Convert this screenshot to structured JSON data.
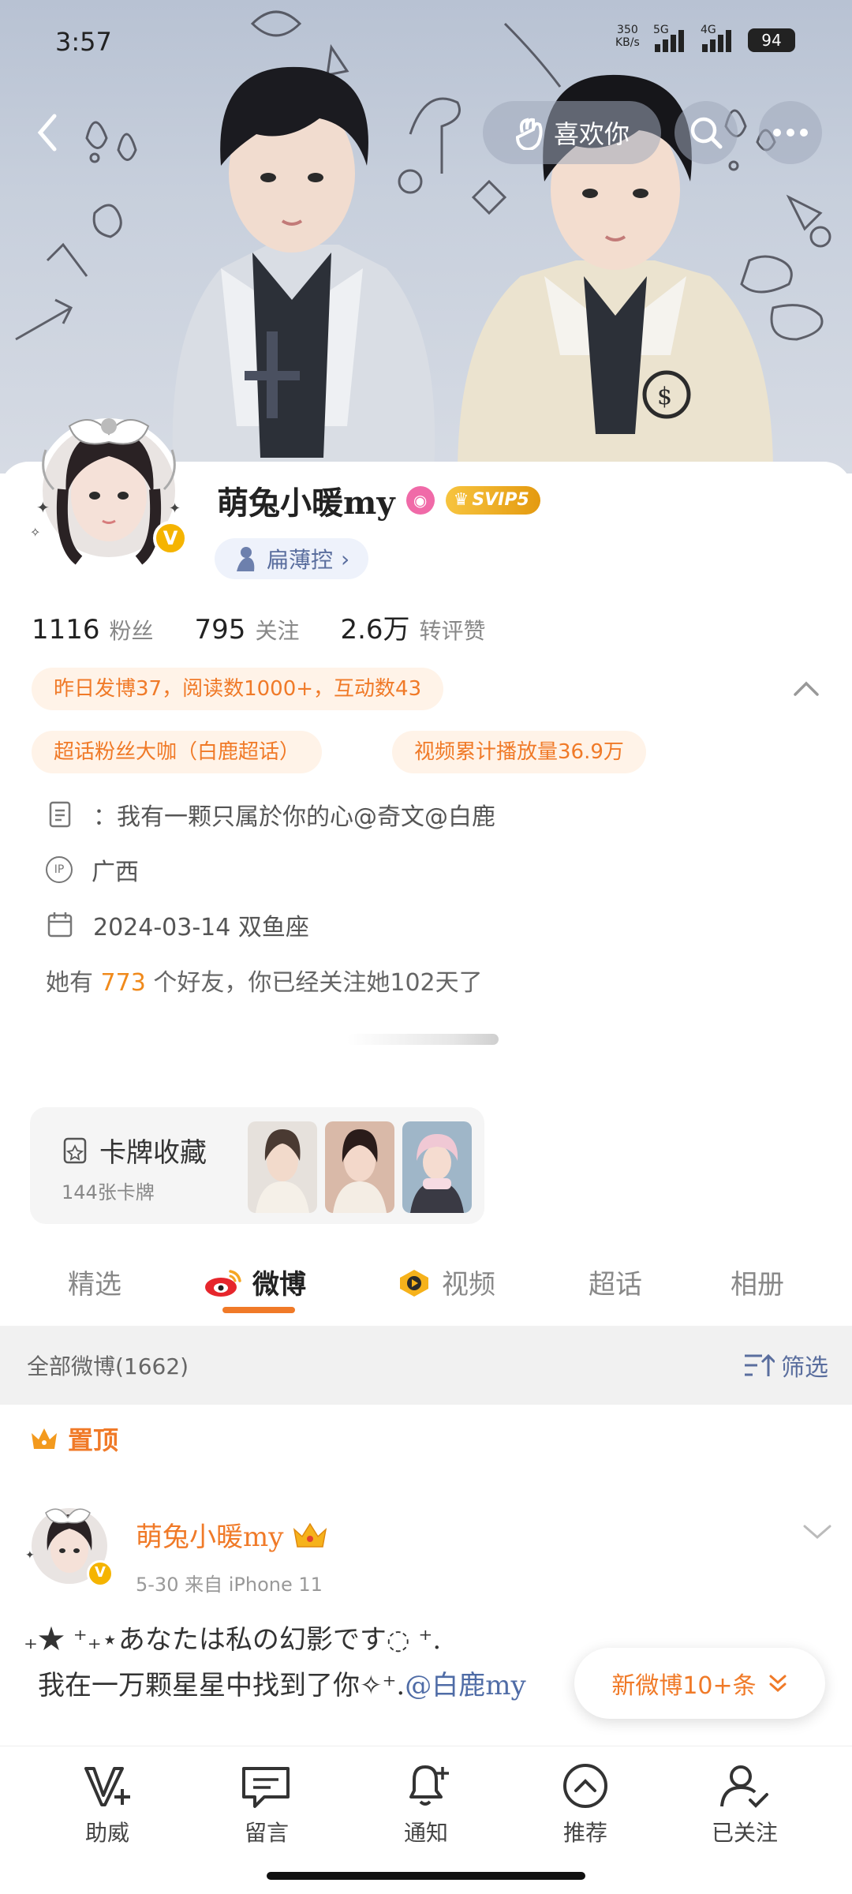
{
  "status_bar": {
    "time": "3:57",
    "net_speed": "350",
    "net_unit": "KB/s",
    "network": "5G",
    "network2": "4G",
    "battery": "94"
  },
  "header": {
    "like_label": "喜欢你"
  },
  "profile": {
    "name": "萌兔小暖my",
    "vip_label": "SVIP5",
    "tag_label": "扁薄控",
    "tag_chevron": "›"
  },
  "stats": [
    {
      "num": "1116",
      "label": "粉丝"
    },
    {
      "num": "795",
      "label": "关注"
    },
    {
      "num": "2.6万",
      "label": "转评赞"
    }
  ],
  "chips": {
    "daily": "昨日发博37，阅读数1000+，互动数43",
    "fan": "超话粉丝大咖（白鹿超话）",
    "video": "视频累计播放量36.9万"
  },
  "info": {
    "bio": "：我有一颗只属於你的心@奇文@白鹿",
    "ip_icon": "IP",
    "location": "广西",
    "birthday": "2024-03-14 双鱼座"
  },
  "friends": {
    "prefix": "她有",
    "count": "773",
    "suffix": "个好友，你已经关注她102天了"
  },
  "cards": {
    "title": "卡牌收藏",
    "subtitle": "144张卡牌"
  },
  "tabs": [
    "精选",
    "微博",
    "视频",
    "超话",
    "相册"
  ],
  "filter": {
    "all_label": "全部微博(1662)",
    "filter_label": "筛选"
  },
  "pinned": {
    "label": "置顶"
  },
  "post": {
    "author": "萌兔小暖my",
    "meta": "5-30  来自 iPhone 11",
    "line1": "₊★ ⁺₊⋆あなたは私の幻影です◌ ⁺.",
    "line2_text": "我在一万颗星星中找到了你✧⁺.",
    "line2_mention": "@白鹿my"
  },
  "new_posts": {
    "label": "新微博10+条"
  },
  "bottom_nav": [
    "助威",
    "留言",
    "通知",
    "推荐",
    "已关注"
  ],
  "colors": {
    "accent": "#f07a28",
    "link": "#5a6e9e",
    "vip_gold": "#f5b400"
  }
}
